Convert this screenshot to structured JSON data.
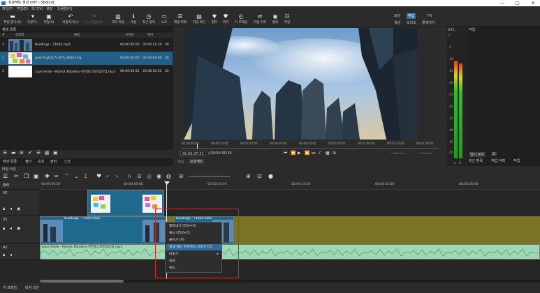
{
  "window": {
    "title": "프로젝트 생성.mlt* - Shotcut",
    "minimize": "—",
    "maximize": "□",
    "close": "✕"
  },
  "menu": [
    "파일(F)",
    "편집(E)",
    "보기(V)",
    "설정",
    "도움말(H)"
  ],
  "toolbar": {
    "items": [
      {
        "label": "파일 열기(O)",
        "icon": "folder-icon",
        "glyph": "▬"
      },
      {
        "label": "다른거..",
        "icon": "open-other-icon",
        "glyph": "▾"
      },
      {
        "label": "저장(S)",
        "icon": "save-icon",
        "glyph": "▣"
      },
      {
        "label": "되돌리기(U)",
        "icon": "undo-icon",
        "glyph": "↶"
      },
      {
        "label": "다시 실행(R)",
        "icon": "redo-icon",
        "glyph": "↷"
      },
      {
        "label": "피크 측정",
        "icon": "peak-meter-icon",
        "glyph": "▥"
      },
      {
        "label": "속성",
        "icon": "properties-icon",
        "glyph": "ℹ"
      },
      {
        "label": "최근 항목",
        "icon": "recent-icon",
        "glyph": "◷"
      },
      {
        "label": "노트",
        "icon": "notes-icon",
        "glyph": "▭"
      },
      {
        "label": "재생 목록",
        "icon": "playlist-icon",
        "glyph": "☰"
      },
      {
        "label": "타임 라인",
        "icon": "timeline-icon",
        "glyph": "▤"
      },
      {
        "label": "필터",
        "icon": "filter-icon",
        "glyph": "▼"
      },
      {
        "label": "마커",
        "icon": "marker-icon",
        "glyph": "♥"
      },
      {
        "label": "키 프레임",
        "icon": "keyframe-icon",
        "glyph": "◴"
      },
      {
        "label": "작업 이력",
        "icon": "history-icon",
        "glyph": "⇌"
      },
      {
        "label": "출력",
        "icon": "export-icon",
        "glyph": "◉"
      },
      {
        "label": "작업",
        "icon": "jobs-icon",
        "glyph": "☷"
      }
    ],
    "layouts_top": [
      "로깅",
      "편집",
      "FX"
    ],
    "layouts_bottom": [
      "색상",
      "오디오",
      "플레이어"
    ],
    "active_layout": "편집"
  },
  "playlist": {
    "header": "재생 목록",
    "columns": [
      "#",
      "섬네일",
      "클립",
      "시작점",
      "길이"
    ],
    "rows": [
      {
        "num": "1",
        "clip": "Buildings - 71844.mp4",
        "in": "00:00:00:00",
        "dur": "00:00:11:30",
        "extra": "00"
      },
      {
        "num": "2",
        "clip": "post-it-gb517cef7b_1920.png",
        "in": "00:00:00:00",
        "dur": "00:00:04:00",
        "extra": "00"
      },
      {
        "num": "3",
        "clip": "Love Aside - Patrick Patrikios-전전랑스타트업도업.mp3",
        "in": "00:00:00:00",
        "dur": "00:02:50:35",
        "extra": "00"
      }
    ],
    "bottom": [
      "재생 목록",
      "필터",
      "속성",
      "출력",
      "노트"
    ]
  },
  "player": {
    "ruler": [
      "00:00:00:00",
      "00:00:10:00",
      "00:00:20:00",
      "00:00:30:00",
      "00:00:40:00",
      "00:00:50:00",
      "00:01:00:00",
      "00:01:10:00",
      "00:01:20:00",
      "00:01:30:00"
    ],
    "current_time": "00:00:07:31",
    "total_time": "/ 00:02:50:35",
    "in_point": "--:--:--:--",
    "out_point": "--:--:--:--",
    "tabs": [
      "소스",
      "프로젝트"
    ],
    "active_tab": "프로젝트"
  },
  "meter": {
    "title": "오디...",
    "scale": [
      "0",
      "-5",
      "-10",
      "-15",
      "-20",
      "-25",
      "-30",
      "-35",
      "-40",
      "-45",
      "-50"
    ],
    "channels": [
      "L",
      "R"
    ],
    "levels": [
      0.8,
      0.78
    ]
  },
  "properties": {
    "title": "작업",
    "buttons": [
      "일시 정지",
      "최근 항목",
      "작업 이력",
      "작업"
    ]
  },
  "timeline": {
    "header": "타임 라인",
    "ruler_label": "출력",
    "ruler": [
      "00:00:00:00",
      "00:00:05:00",
      "00:00:10:00",
      "00:00:15:00",
      "00:00:20:00",
      "00:00:25:00"
    ],
    "tracks": [
      {
        "name": "V2",
        "type": "video"
      },
      {
        "name": "V1",
        "type": "video"
      },
      {
        "name": "A1",
        "type": "audio"
      }
    ],
    "clips": {
      "v2": "post-it-gb517cef7b_1920.png",
      "v1a": "Buildings - 71844.mp4",
      "v1b": "Buildings - 71844.mp4",
      "a1": "Love Aside - Patrick Patrikios-전전랑스타트업도업.mp3"
    }
  },
  "context_menu": {
    "items": [
      "잘라내기 (Ctrl+X)",
      "복사 (Ctrl+C)",
      "붙이기 (V)",
      "재생 헤드 위치에서 자르기 (S)",
      "더보기",
      "속성",
      "취소"
    ],
    "highlighted_index": 3
  },
  "bottom_tabs": [
    "키 프레임",
    "타임 라인"
  ],
  "colors": {
    "selection": "#215f87",
    "highlight": "#2f6c9c",
    "video_track": "#7b7426",
    "audio_track": "#9fd8b5",
    "annotation_box": "#e02222"
  }
}
